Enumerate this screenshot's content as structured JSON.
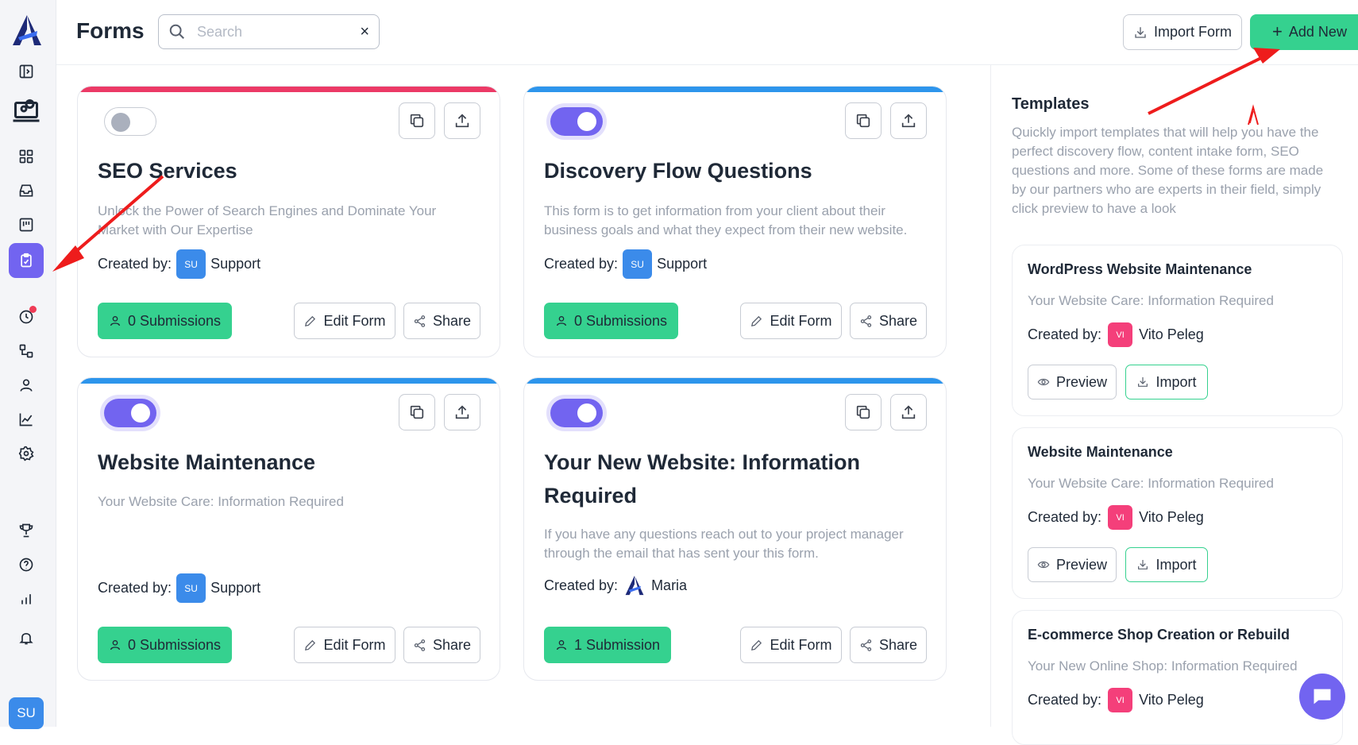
{
  "header": {
    "title": "Forms",
    "search_placeholder": "Search",
    "clear_icon": "×",
    "import_label": "Import Form",
    "add_label": "Add New"
  },
  "sidebar": {
    "items": [
      "toggle-sidebar-icon",
      "agency-icon",
      "dashboard-icon",
      "inbox-icon",
      "boards-icon",
      "forms-icon",
      "time-icon",
      "workflows-icon",
      "contacts-icon",
      "reports-icon",
      "settings-icon",
      "trophy-icon",
      "help-icon",
      "stats-icon",
      "bell-icon"
    ],
    "active": "forms-icon",
    "user_initials": "SU"
  },
  "forms": [
    {
      "title": "SEO Services",
      "description": "Unlock the Power of Search Engines and Dominate Your Market with Our Expertise",
      "created_label": "Created by:",
      "author": "Support",
      "author_initials": "SU",
      "submissions": "0 Submissions",
      "enabled": false,
      "bar_color": "#ec3a66"
    },
    {
      "title": "Discovery Flow Questions",
      "description": "This form is to get information from your client about their business goals and what they expect from their new website.",
      "created_label": "Created by:",
      "author": "Support",
      "author_initials": "SU",
      "submissions": "0 Submissions",
      "enabled": true,
      "bar_color": "#2d95ec"
    },
    {
      "title": "Website Maintenance",
      "description": "Your Website Care: Information Required",
      "created_label": "Created by:",
      "author": "Support",
      "author_initials": "SU",
      "submissions": "0 Submissions",
      "enabled": true,
      "bar_color": "#2d95ec"
    },
    {
      "title": "Your New Website: Information Required",
      "description": "If you have any questions reach out to your project manager through the email that has sent your this form.",
      "created_label": "Created by:",
      "author": "Maria",
      "submissions": "1 Submission",
      "enabled": true,
      "bar_color": "#2d95ec"
    }
  ],
  "form_actions": {
    "edit": "Edit Form",
    "share": "Share"
  },
  "templates": {
    "heading": "Templates",
    "intro": "Quickly import templates that will help you have the perfect discovery flow, content intake form, SEO questions and more. Some of these forms are made by our partners who are experts in their field, simply click preview to have a look",
    "preview_label": "Preview",
    "import_label": "Import",
    "created_label": "Created by:",
    "items": [
      {
        "name": "WordPress Website Maintenance",
        "subtitle": "Your Website Care: Information Required",
        "author": "Vito Peleg",
        "author_initials": "VI"
      },
      {
        "name": "Website Maintenance",
        "subtitle": "Your Website Care: Information Required",
        "author": "Vito Peleg",
        "author_initials": "VI"
      },
      {
        "name": "E-commerce Shop Creation or Rebuild",
        "subtitle": "Your New Online Shop: Information Required",
        "author": "Vito Peleg",
        "author_initials": "VI"
      }
    ]
  },
  "colors": {
    "accent": "#7264f0",
    "green": "#35d18f",
    "annotation_arrow": "#ee1c1c"
  }
}
